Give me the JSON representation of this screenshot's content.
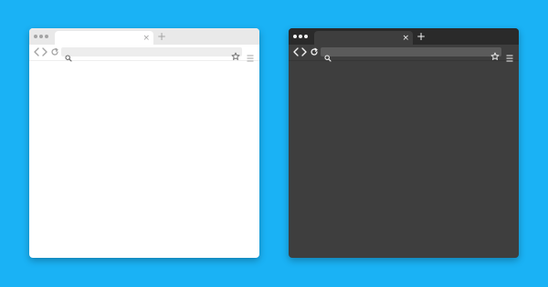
{
  "colors": {
    "background": "#1ab2f5",
    "light_window": "#ffffff",
    "light_titlebar": "#e9e9e9",
    "light_url_bar": "#ededed",
    "light_icon": "#a4a4a4",
    "dark_window": "#3e3e3e",
    "dark_titlebar": "#2a2a2a",
    "dark_url_bar": "#5b5b5b",
    "dark_icon": "#f2f2f2"
  },
  "browsers": [
    {
      "theme": "light",
      "tab": {
        "close_glyph": "×"
      },
      "new_tab_glyph": "+",
      "icons": [
        "back-icon",
        "forward-icon",
        "reload-icon",
        "search-icon",
        "star-icon",
        "menu-icon"
      ]
    },
    {
      "theme": "dark",
      "tab": {
        "close_glyph": "×"
      },
      "new_tab_glyph": "+",
      "icons": [
        "back-icon",
        "forward-icon",
        "reload-icon",
        "search-icon",
        "star-icon",
        "menu-icon"
      ]
    }
  ]
}
